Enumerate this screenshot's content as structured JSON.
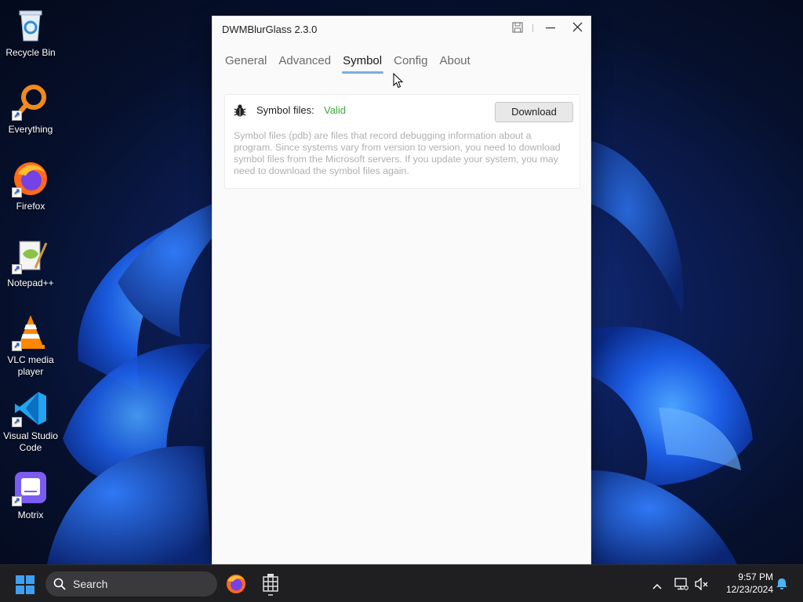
{
  "desktop": {
    "icons": [
      {
        "label": "Recycle Bin"
      },
      {
        "label": "Everything"
      },
      {
        "label": "Firefox"
      },
      {
        "label": "Notepad++"
      },
      {
        "label": "VLC media player"
      },
      {
        "label": "Visual Studio Code"
      },
      {
        "label": "Motrix"
      }
    ]
  },
  "window": {
    "title": "DWMBlurGlass 2.3.0",
    "tabs": [
      "General",
      "Advanced",
      "Symbol",
      "Config",
      "About"
    ],
    "active_tab": "Symbol",
    "symbol": {
      "label": "Symbol files:",
      "status": "Valid",
      "download_label": "Download",
      "description": "Symbol files (pdb) are files that record debugging information about a program. Since systems vary from version to version, you need to download symbol files from the Microsoft servers. If you update your system, you may need to download the symbol files again."
    }
  },
  "taskbar": {
    "search_placeholder": "Search",
    "time": "9:57 PM",
    "date": "12/23/2024"
  },
  "colors": {
    "accent": "#7aaee0",
    "status_valid": "#3caa3c",
    "taskbar_bg": "#1f1f21"
  }
}
